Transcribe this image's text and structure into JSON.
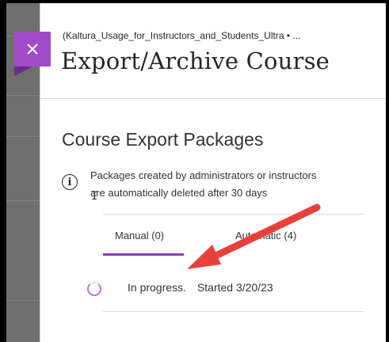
{
  "header": {
    "breadcrumb": "(Kaltura_Usage_for_Instructors_and_Students_Ultra • ...",
    "title": "Export/Archive Course"
  },
  "close_icon": "close-icon",
  "section": {
    "title": "Course Export Packages",
    "info_icon": "info-icon",
    "info_line1": "Packages created by administrators or instructors",
    "info_line2": "are automatically deleted after 30 days"
  },
  "tabs": [
    {
      "label": "Manual (0)",
      "active": true
    },
    {
      "label": "Automatic (4)",
      "active": false
    }
  ],
  "package_row": {
    "status": "In progress.",
    "started": "Started 3/20/23"
  },
  "colors": {
    "accent": "#a24bc8",
    "annotation_arrow": "#e8413c"
  }
}
